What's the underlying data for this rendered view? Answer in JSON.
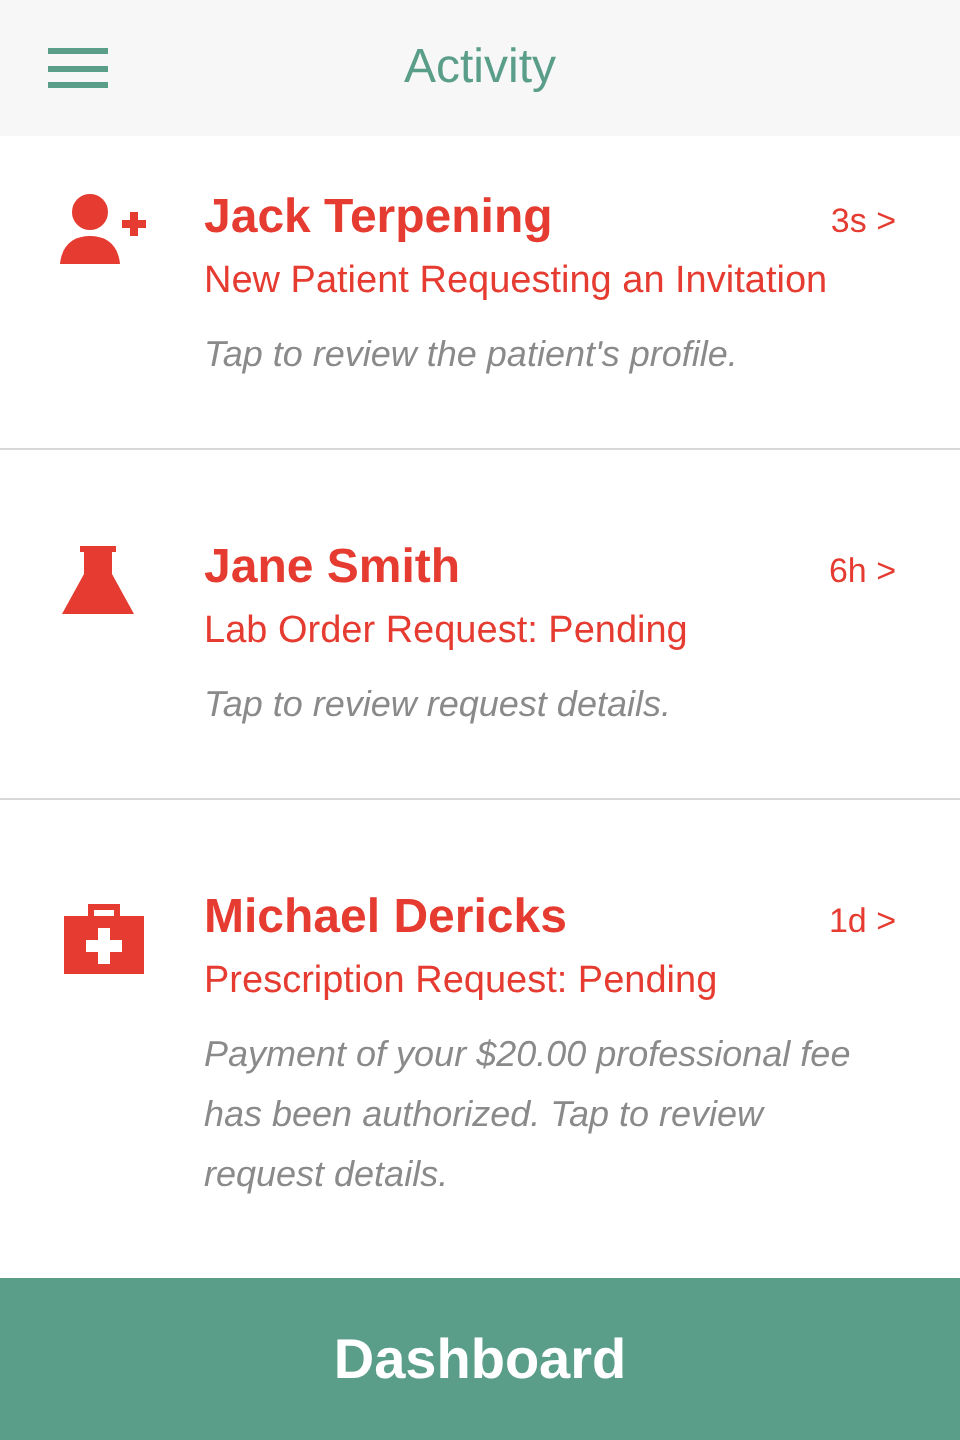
{
  "header": {
    "title": "Activity"
  },
  "activities": [
    {
      "kind": "patient",
      "name": "Jack Terpening",
      "time": "3s >",
      "subtitle": "New Patient Requesting an Invitation",
      "note": "Tap to review the patient's profile."
    },
    {
      "kind": "lab",
      "name": "Jane Smith",
      "time": "6h >",
      "subtitle": "Lab Order Request: Pending",
      "note": "Tap to review request details."
    },
    {
      "kind": "prescription",
      "name": "Michael Dericks",
      "time": "1d >",
      "subtitle": "Prescription Request: Pending",
      "note": "Payment of your $20.00 professional fee has been authorized. Tap to review request details."
    }
  ],
  "footer": {
    "label": "Dashboard"
  }
}
